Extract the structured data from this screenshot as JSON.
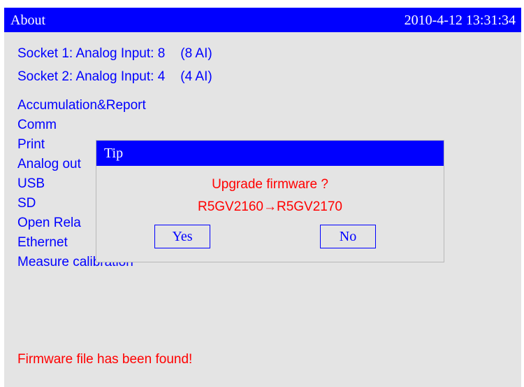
{
  "titlebar": {
    "title": "About",
    "datetime": "2010-4-12 13:31:34"
  },
  "sockets": [
    {
      "label": "Socket 1: Analog Input: 8",
      "detail": "(8 AI)"
    },
    {
      "label": "Socket 2: Analog Input: 4",
      "detail": "(4 AI)"
    }
  ],
  "features": [
    "Accumulation&Report",
    "Comm",
    "Print",
    "Analog out",
    "USB",
    "SD",
    "Open Rela",
    "Ethernet",
    "Measure calibration"
  ],
  "status_message": "Firmware file has been found!",
  "dialog": {
    "title": "Tip",
    "question": "Upgrade firmware ?",
    "version_change": "R5GV2160→R5GV2170",
    "yes_label": "Yes",
    "no_label": "No"
  },
  "colors": {
    "title_bar": "#0000ff",
    "text": "#0000ff",
    "alert_text": "#ff0000",
    "panel_bg": "#e4e4e4"
  }
}
